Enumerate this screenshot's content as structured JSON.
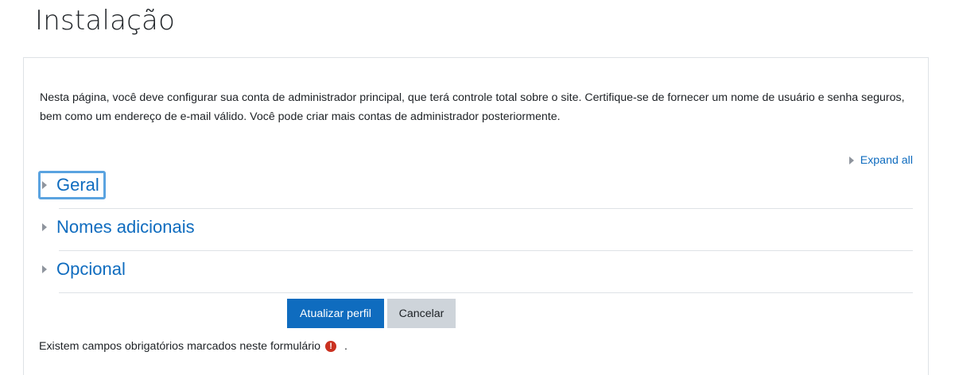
{
  "page": {
    "title": "Instalação"
  },
  "intro": {
    "text": "Nesta página, você deve configurar sua conta de administrador principal, que terá controle total sobre o site. Certifique-se de fornecer um nome de usuário e senha seguros, bem como um endereço de e-mail válido. Você pode criar mais contas de administrador posteriormente."
  },
  "expand_all": {
    "label": "Expand all"
  },
  "sections": [
    {
      "label": "Geral",
      "icon": "caret-right-icon",
      "focused": true
    },
    {
      "label": "Nomes adicionais",
      "icon": "caret-right-icon",
      "focused": false
    },
    {
      "label": "Opcional",
      "icon": "caret-right-icon",
      "focused": false
    }
  ],
  "buttons": {
    "submit_label": "Atualizar perfil",
    "cancel_label": "Cancelar"
  },
  "required_note": {
    "text": "Existem campos obrigatórios marcados neste formulário",
    "icon": "required-exclamation-icon",
    "icon_glyph": "!",
    "suffix": "."
  },
  "colors": {
    "link": "#0f6cbf",
    "primary_button": "#0f6cbf",
    "secondary_button": "#ced4da",
    "required_icon": "#ca3120",
    "focus_outline": "#5aa3e0"
  }
}
